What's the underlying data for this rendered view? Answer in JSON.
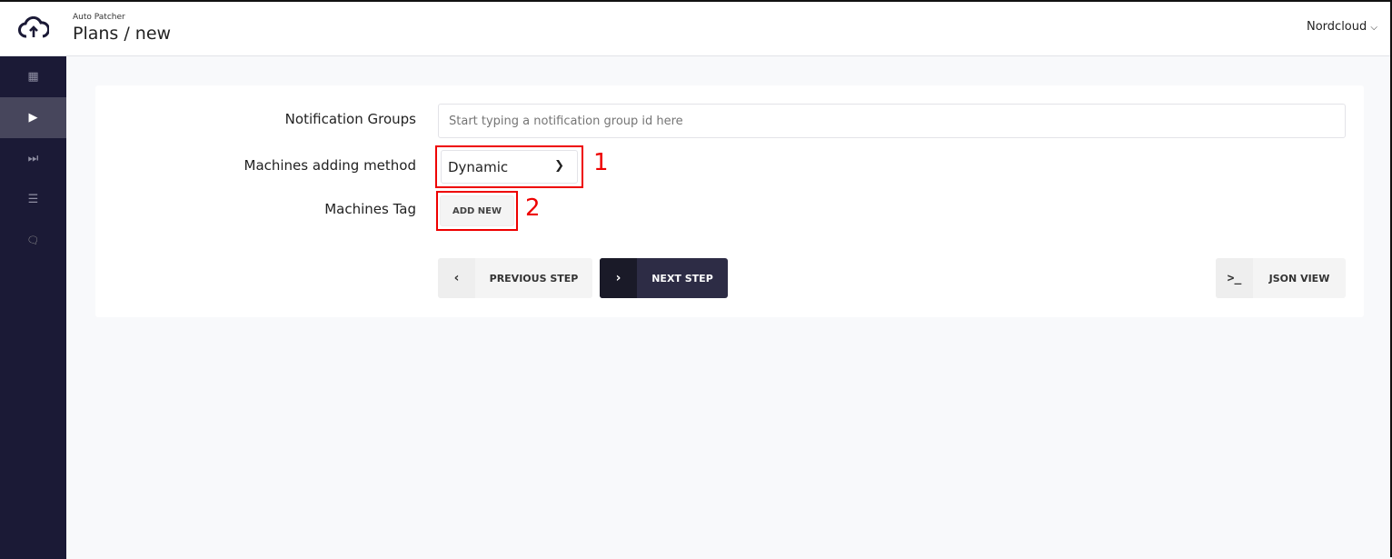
{
  "header": {
    "app_name": "Auto Patcher",
    "title": "Plans / new",
    "org": "Nordcloud",
    "org_chevron": "⌵"
  },
  "sidebar": {
    "items": [
      {
        "icon": "calendar-icon",
        "glyph": "▦"
      },
      {
        "icon": "play-icon",
        "glyph": "▶",
        "active": true
      },
      {
        "icon": "step-forward-icon",
        "glyph": "⏭"
      },
      {
        "icon": "list-icon",
        "glyph": "☰"
      },
      {
        "icon": "comments-icon",
        "glyph": "🗨"
      }
    ]
  },
  "form": {
    "notification_label": "Notification Groups",
    "notification_placeholder": "Start typing a notification group id here",
    "method_label": "Machines adding method",
    "method_value": "Dynamic",
    "tag_label": "Machines Tag",
    "add_new": "ADD NEW"
  },
  "annotations": {
    "one": "1",
    "two": "2",
    "color": "#ee0000"
  },
  "buttons": {
    "prev_icon": "‹",
    "prev": "PREVIOUS STEP",
    "next_icon": "›",
    "next": "NEXT STEP",
    "json_icon": ">_",
    "json": "JSON VIEW"
  }
}
